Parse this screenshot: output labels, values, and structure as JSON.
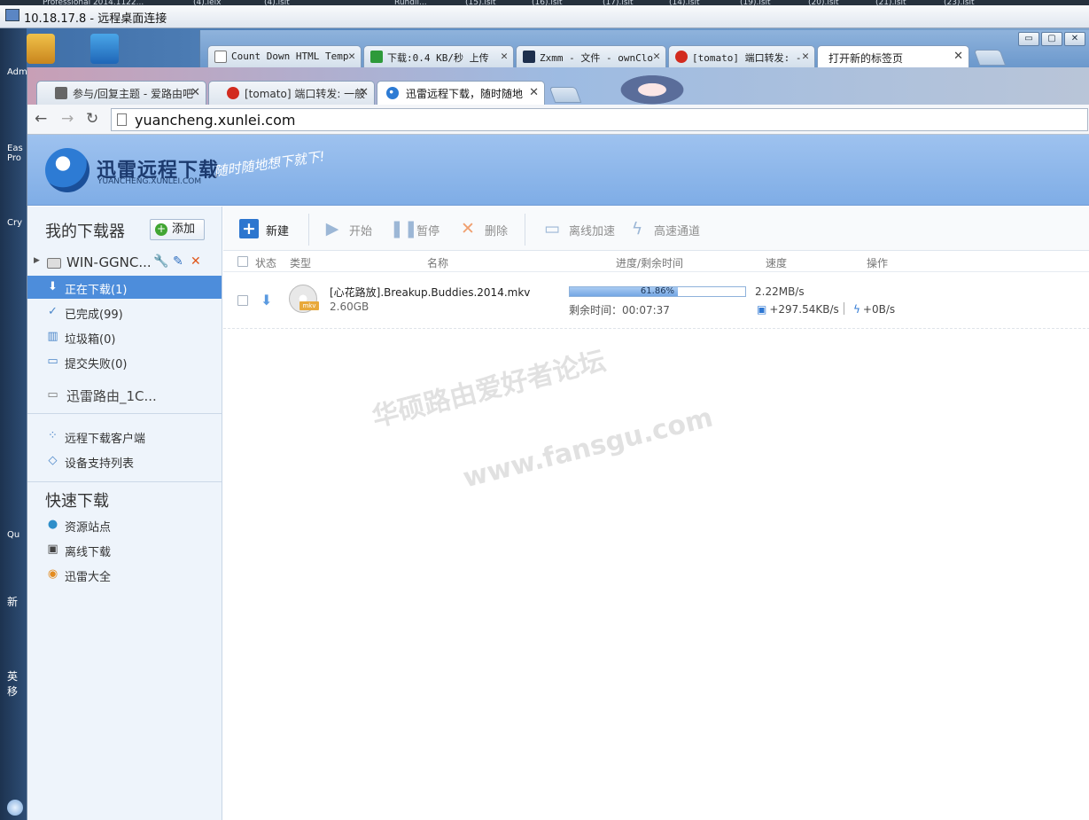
{
  "remote_desktop": {
    "title": "10.18.17.8 - 远程桌面连接",
    "cut_texts": [
      "Professional 2014.1122...",
      "(4).lelx",
      "(4).lsit",
      "Rundll...",
      "(15).lsit",
      "(16).lsit",
      "(17).lsit",
      "(14).lsit",
      "(19).lsit",
      "(20).lsit",
      "(21).lsit",
      "(23).lsit"
    ]
  },
  "desktop": {
    "labels": [
      "Adm",
      "Eas Pro",
      "Cry",
      "Qu",
      "新",
      "英 移"
    ]
  },
  "outer_browser": {
    "tabs": [
      {
        "label": "Count Down HTML Temp",
        "icon": "page-icon"
      },
      {
        "label": "下载:0.4 KB/秒 上传",
        "icon": "green-square-icon"
      },
      {
        "label": "Zxmm - 文件 - ownClo",
        "icon": "cloud-icon"
      },
      {
        "label": "[tomato] 端口转发: -",
        "icon": "tomato-icon"
      },
      {
        "label": "打开新的标签页",
        "icon": "none"
      }
    ],
    "window_buttons": [
      "▭",
      "▢",
      "✕"
    ]
  },
  "inner_browser": {
    "tabs": [
      {
        "label": "参与/回复主题 - 爱路由吧",
        "icon": "router-icon"
      },
      {
        "label": "[tomato] 端口转发: 一般",
        "icon": "tomato-icon"
      },
      {
        "label": "迅雷远程下载，随时随地",
        "icon": "xunlei-icon"
      }
    ],
    "url": "yuancheng.xunlei.com"
  },
  "header": {
    "logo_title": "迅雷远程下载",
    "logo_sub": "YUANCHENG.XUNLEI.COM",
    "slogan": "随时随地想下就下!"
  },
  "sidebar": {
    "title": "我的下载器",
    "add_label": "添加",
    "device_name": "WIN-GGNC...",
    "items": [
      {
        "label": "正在下载(1)",
        "icon": "download-arrow-icon",
        "selected": true
      },
      {
        "label": "已完成(99)",
        "icon": "check-icon",
        "selected": false
      },
      {
        "label": "垃圾箱(0)",
        "icon": "trash-icon",
        "selected": false
      },
      {
        "label": "提交失败(0)",
        "icon": "failed-doc-icon",
        "selected": false
      }
    ],
    "router": "迅雷路由_1C...",
    "links": [
      {
        "label": "远程下载客户端",
        "icon": "client-icon"
      },
      {
        "label": "设备支持列表",
        "icon": "layers-icon"
      }
    ],
    "quick_title": "快速下载",
    "quick_items": [
      {
        "label": "资源站点",
        "icon": "globe-icon"
      },
      {
        "label": "离线下载",
        "icon": "offline-icon"
      },
      {
        "label": "迅雷大全",
        "icon": "browser-icon"
      }
    ]
  },
  "toolbar": {
    "new": "新建",
    "start": "开始",
    "pause": "暂停",
    "delete": "删除",
    "offline_accel": "离线加速",
    "fast_channel": "高速通道"
  },
  "table": {
    "headers": {
      "status": "状态",
      "type": "类型",
      "name": "名称",
      "progress": "进度/剩余时间",
      "speed": "速度",
      "ops": "操作"
    },
    "task": {
      "name": "[心花路放].Breakup.Buddies.2014.mkv",
      "size": "2.60GB",
      "file_ext": "mkv",
      "progress": 61.86,
      "progress_text": "61.86%",
      "remain": "剩余时间：00:07:37",
      "speed": "2.22MB/s",
      "accel_speed": "+297.54KB/s",
      "fast_speed": "+0B/s"
    }
  },
  "watermark": {
    "line1": "华硕路由爱好者论坛",
    "line2": "www.fansgu.com"
  },
  "colors": {
    "selected_item": "#4d8ddb",
    "header_blue": "#8db8ec",
    "progress": "#74a6e4",
    "accent": "#2d76cf"
  }
}
